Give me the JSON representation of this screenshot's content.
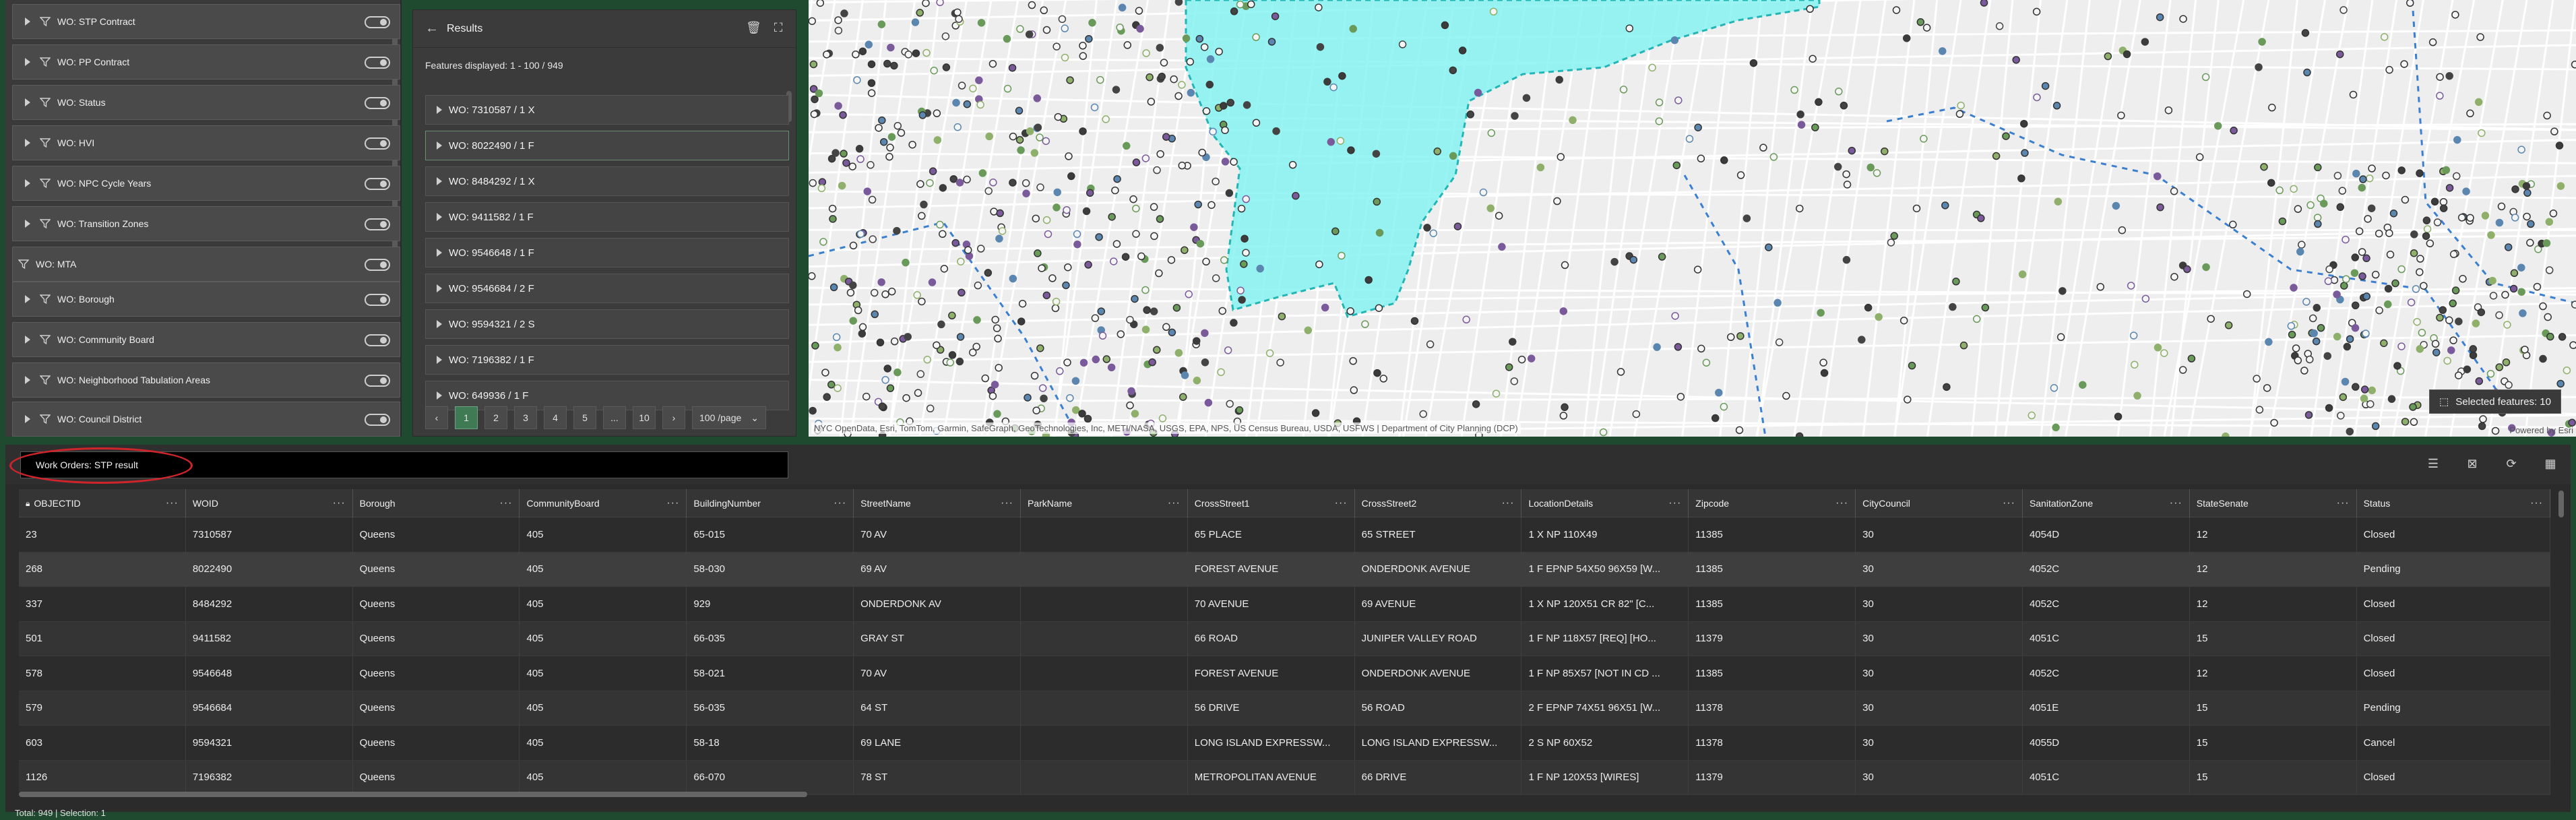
{
  "layers": [
    {
      "label": "WO: STP Contract",
      "expandable": true
    },
    {
      "label": "WO: PP Contract",
      "expandable": true
    },
    {
      "label": "WO: Status",
      "expandable": true
    },
    {
      "label": "WO: HVI",
      "expandable": true
    },
    {
      "label": "WO: NPC Cycle Years",
      "expandable": true
    },
    {
      "label": "WO: Transition Zones",
      "expandable": true
    },
    {
      "label": "WO: MTA",
      "expandable": false
    },
    {
      "label": "WO: Borough",
      "expandable": true
    },
    {
      "label": "WO: Community Board",
      "expandable": true
    },
    {
      "label": "WO: Neighborhood Tabulation Areas",
      "expandable": true
    },
    {
      "label": "WO: Council District",
      "expandable": true
    }
  ],
  "results": {
    "title": "Results",
    "features_displayed": "Features displayed: 1 - 100 / 949",
    "items": [
      "WO: 7310587 / 1 X",
      "WO: 8022490 / 1 F",
      "WO: 8484292 / 1 X",
      "WO: 9411582 / 1 F",
      "WO: 9546648 / 1 F",
      "WO: 9546684 / 2 F",
      "WO: 9594321 / 2 S",
      "WO: 7196382 / 1 F",
      "WO: 649936 / 1 F"
    ],
    "pages": [
      "1",
      "2",
      "3",
      "4",
      "5",
      "...",
      "10"
    ],
    "page_size": "100 /page"
  },
  "map": {
    "attribution": "NYC OpenData, Esri, TomTom, Garmin, SafeGraph, GeoTechnologies, Inc, METI/NASA, USGS, EPA, NPS, US Census Bureau, USDA, USFWS | Department of City Planning (DCP)",
    "selected_features": "Selected features: 10",
    "powered_by": "Powered by Esri",
    "highlight_color": "#7ff2f0"
  },
  "table": {
    "layer_select": "Work Orders: STP result",
    "columns": [
      "OBJECTID",
      "WOID",
      "Borough",
      "CommunityBoard",
      "BuildingNumber",
      "StreetName",
      "ParkName",
      "CrossStreet1",
      "CrossStreet2",
      "LocationDetails",
      "Zipcode",
      "CityCouncil",
      "SanitationZone",
      "StateSenate",
      "Status"
    ],
    "rows": [
      [
        "23",
        "7310587",
        "Queens",
        "405",
        "65-015",
        "70 AV",
        "",
        "65 PLACE",
        "65 STREET",
        "1 X NP 110X49",
        "11385",
        "30",
        "4054D",
        "12",
        "Closed"
      ],
      [
        "268",
        "8022490",
        "Queens",
        "405",
        "58-030",
        "69 AV",
        "",
        "FOREST AVENUE",
        "ONDERDONK AVENUE",
        "1 F EPNP 54X50 96X59 [W...",
        "11385",
        "30",
        "4052C",
        "12",
        "Pending"
      ],
      [
        "337",
        "8484292",
        "Queens",
        "405",
        "929",
        "ONDERDONK AV",
        "",
        "70 AVENUE",
        "69 AVENUE",
        "1 X NP 120X51 CR 82\" [C...",
        "11385",
        "30",
        "4052C",
        "12",
        "Closed"
      ],
      [
        "501",
        "9411582",
        "Queens",
        "405",
        "66-035",
        "GRAY ST",
        "",
        "66 ROAD",
        "JUNIPER VALLEY ROAD",
        "1 F NP 118X57 [REQ] [HO...",
        "11379",
        "30",
        "4051C",
        "15",
        "Closed"
      ],
      [
        "578",
        "9546648",
        "Queens",
        "405",
        "58-021",
        "70 AV",
        "",
        "FOREST AVENUE",
        "ONDERDONK AVENUE",
        "1 F NP 85X57 [NOT IN CD ...",
        "11385",
        "30",
        "4052C",
        "12",
        "Closed"
      ],
      [
        "579",
        "9546684",
        "Queens",
        "405",
        "56-035",
        "64 ST",
        "",
        "56 DRIVE",
        "56 ROAD",
        "2 F EPNP 74X51 96X51 [W...",
        "11378",
        "30",
        "4051E",
        "15",
        "Pending"
      ],
      [
        "603",
        "9594321",
        "Queens",
        "405",
        "58-18",
        "69 LANE",
        "",
        "LONG ISLAND EXPRESSW...",
        "LONG ISLAND EXPRESSW...",
        "2 S NP 60X52",
        "11378",
        "30",
        "4055D",
        "15",
        "Cancel"
      ],
      [
        "1126",
        "7196382",
        "Queens",
        "405",
        "66-070",
        "78 ST",
        "",
        "METROPOLITAN AVENUE",
        "66 DRIVE",
        "1 F NP 120X53 [WIRES]",
        "11379",
        "30",
        "4051C",
        "15",
        "Closed"
      ]
    ],
    "footer": "Total: 949 | Selection: 1"
  }
}
